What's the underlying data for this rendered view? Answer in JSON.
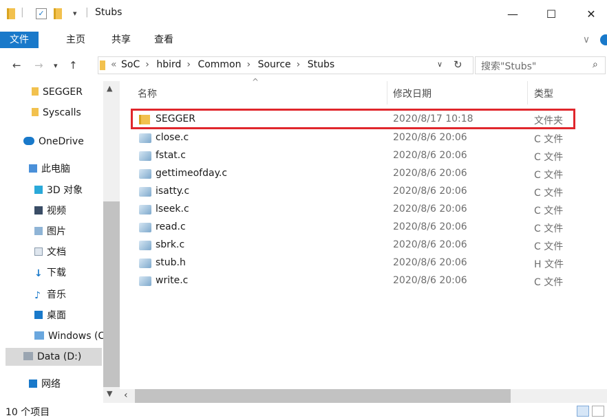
{
  "window": {
    "title": "Stubs",
    "controls": {
      "minimize": "—",
      "maximize": "☐",
      "close": "✕"
    }
  },
  "ribbon": {
    "tabs": [
      "文件",
      "主页",
      "共享",
      "查看"
    ],
    "collapse": "∨"
  },
  "address": {
    "path": [
      "«",
      "SoC",
      "hbird",
      "Common",
      "Source",
      "Stubs"
    ],
    "search_placeholder": "搜索\"Stubs\""
  },
  "sidebar": {
    "items": [
      {
        "label": "SEGGER",
        "icon": "folder-icon"
      },
      {
        "label": "Syscalls",
        "icon": "folder-icon"
      },
      {
        "label": "OneDrive",
        "icon": "cloud-icon"
      },
      {
        "label": "此电脑",
        "icon": "computer-icon"
      },
      {
        "label": "3D 对象",
        "icon": "cube-icon"
      },
      {
        "label": "视频",
        "icon": "video-icon"
      },
      {
        "label": "图片",
        "icon": "picture-icon"
      },
      {
        "label": "文档",
        "icon": "document-icon"
      },
      {
        "label": "下载",
        "icon": "download-icon"
      },
      {
        "label": "音乐",
        "icon": "music-icon"
      },
      {
        "label": "桌面",
        "icon": "desktop-icon"
      },
      {
        "label": "Windows (C",
        "icon": "drive-icon"
      },
      {
        "label": "Data (D:)",
        "icon": "drive-icon"
      },
      {
        "label": "网络",
        "icon": "network-icon"
      }
    ]
  },
  "columns": {
    "name": "名称",
    "date": "修改日期",
    "type": "类型"
  },
  "files": [
    {
      "name": "SEGGER",
      "date": "2020/8/17 10:18",
      "type": "文件夹",
      "icon": "folder-icon"
    },
    {
      "name": "close.c",
      "date": "2020/8/6 20:06",
      "type": "C 文件",
      "icon": "c-file-icon"
    },
    {
      "name": "fstat.c",
      "date": "2020/8/6 20:06",
      "type": "C 文件",
      "icon": "c-file-icon"
    },
    {
      "name": "gettimeofday.c",
      "date": "2020/8/6 20:06",
      "type": "C 文件",
      "icon": "c-file-icon"
    },
    {
      "name": "isatty.c",
      "date": "2020/8/6 20:06",
      "type": "C 文件",
      "icon": "c-file-icon"
    },
    {
      "name": "lseek.c",
      "date": "2020/8/6 20:06",
      "type": "C 文件",
      "icon": "c-file-icon"
    },
    {
      "name": "read.c",
      "date": "2020/8/6 20:06",
      "type": "C 文件",
      "icon": "c-file-icon"
    },
    {
      "name": "sbrk.c",
      "date": "2020/8/6 20:06",
      "type": "C 文件",
      "icon": "c-file-icon"
    },
    {
      "name": "stub.h",
      "date": "2020/8/6 20:06",
      "type": "H 文件",
      "icon": "h-file-icon"
    },
    {
      "name": "write.c",
      "date": "2020/8/6 20:06",
      "type": "C 文件",
      "icon": "c-file-icon"
    }
  ],
  "status": {
    "item_count": "10 个项目"
  },
  "colors": {
    "accent": "#1979ca",
    "highlight_border": "#e0262c",
    "folder": "#f2c14e"
  }
}
